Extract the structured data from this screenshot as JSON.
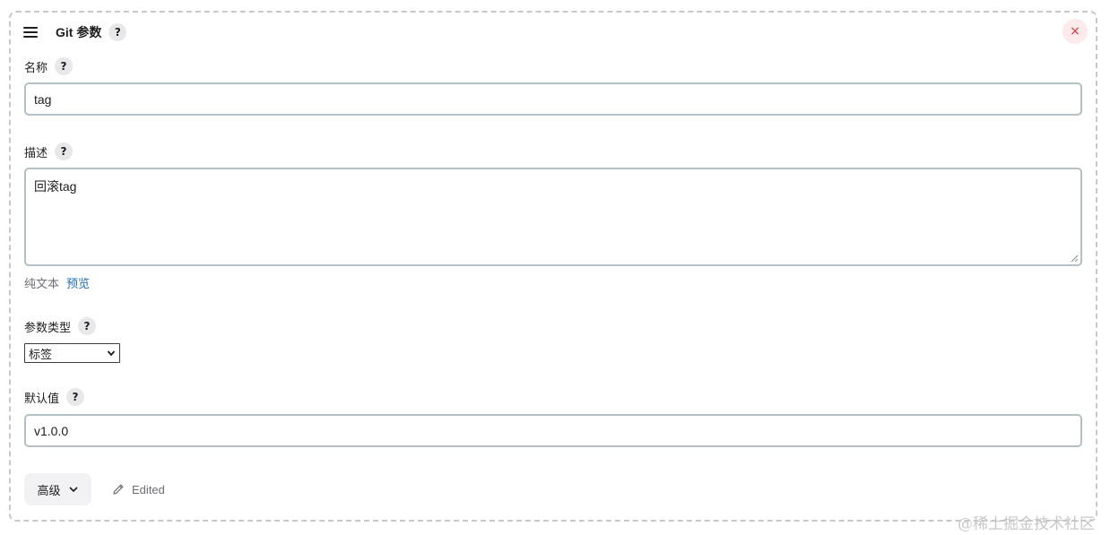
{
  "header": {
    "title": "Git 参数",
    "help": "?",
    "close_icon": "×"
  },
  "fields": {
    "name": {
      "label": "名称",
      "help": "?",
      "value": "tag"
    },
    "description": {
      "label": "描述",
      "help": "?",
      "value": "回滚tag"
    },
    "format": {
      "plain_text": "纯文本",
      "preview": "预览"
    },
    "param_type": {
      "label": "参数类型",
      "help": "?",
      "selected": "标签"
    },
    "default_value": {
      "label": "默认值",
      "help": "?",
      "value": "v1.0.0"
    }
  },
  "footer": {
    "advanced_label": "高级",
    "edited_label": "Edited"
  },
  "watermark": "@稀土掘金技术社区",
  "icons": {
    "drag": "drag-handle-icon",
    "close": "close-icon",
    "chevron": "chevron-down-icon",
    "pencil": "pencil-icon"
  },
  "colors": {
    "close_bg": "#fdeaea",
    "close_fg": "#e0313a",
    "link": "#1f6fb8",
    "input_border": "#b5c0c4",
    "card_border": "#c7c7cc"
  }
}
